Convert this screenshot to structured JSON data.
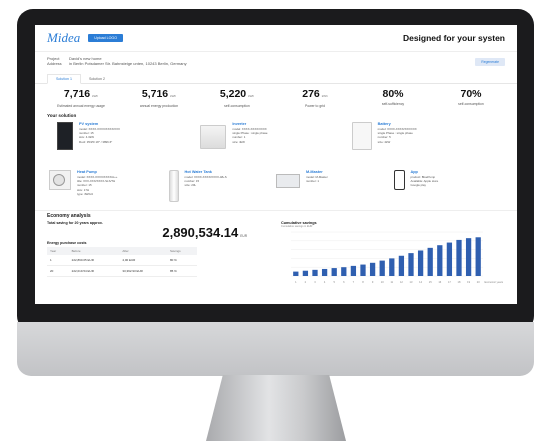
{
  "header": {
    "logo": "Midea",
    "upload_label": "Upload LOGO",
    "tagline": "Designed for your systen"
  },
  "project": {
    "project_key": "Project",
    "project_value": "David's new home",
    "address_key": "Address",
    "address_value": "in Berlin Potsdamer Str. Bahnsteige unten, 10243 Berlin, Germany",
    "regen_label": "Regenerate"
  },
  "tabs": [
    {
      "label": "Solution 1"
    },
    {
      "label": "Solution 2"
    }
  ],
  "kpis": [
    {
      "value": "7,716",
      "unit": "kWh",
      "label": "Estimated annual energy usage"
    },
    {
      "value": "5,716",
      "unit": "kWh",
      "label": "annual energy production"
    },
    {
      "value": "5,220",
      "unit": "kWh",
      "label": "self-consumption"
    },
    {
      "value": "276",
      "unit": "kWh",
      "label": "Power to grid"
    },
    {
      "value": "80%",
      "unit": "",
      "label": "self-sufficiency"
    },
    {
      "value": "70%",
      "unit": "",
      "label": "self-consumption"
    }
  ],
  "solution_title": "Your solution",
  "products": [
    {
      "title": "PV system",
      "lines": [
        "model: XXXX-XXXX/XXXX/XXX",
        "number: 15",
        "size: 4.3kW",
        "Roof: 35/25/ 18° / 3896.6°"
      ]
    },
    {
      "title": "Inverter",
      "lines": [
        "model: XXXX-XXXX/XXXX",
        "single Phase : single phase",
        "number: 1",
        "size: 4kW"
      ]
    },
    {
      "title": "Battery",
      "lines": [
        "model: XXXX-XXXX/XXXX/XX",
        "single Phase : single phase",
        "number: 5",
        "size: 4kW"
      ]
    },
    {
      "title": "Heat Pump",
      "lines": [
        "model: XXXX-XXXX/XXXX/A++",
        "title: XXX-XXX/XXXX-SLS/TH",
        "number: 15",
        "size: 17H",
        "type: 4W/H4"
      ]
    },
    {
      "title": "Hot Water Tank",
      "lines": [
        "model: XXXX-XXXX/XXXX-48+S",
        "number: 15",
        "size: 20L"
      ]
    },
    {
      "title": "M-Master",
      "lines": [
        "model: M-Master",
        "number: 1"
      ]
    },
    {
      "title": "App",
      "lines": [
        "product: BluePump",
        "Available: Apple store",
        "Google play"
      ]
    }
  ],
  "economy": {
    "title": "Economy analysis",
    "total_label": "Total saving for 20 years approx.",
    "total_value": "2,890,534.14",
    "total_unit": "EUR",
    "costs_title": "Energy purchase costs",
    "columns": [
      "Year",
      "Before",
      "After",
      "Savings"
    ],
    "rows": [
      [
        "1",
        "222,890.05 EUR",
        "4,00 EUR",
        "80 %"
      ],
      [
        "20",
        "222,019.54 EUR",
        "33,392.93 EUR",
        "85 %"
      ]
    ]
  },
  "chart_data": {
    "type": "bar",
    "title": "Cumulative savings",
    "subtitle": "Cumulative savings in EUR",
    "categories": [
      "1",
      "2",
      "3",
      "4",
      "5",
      "6",
      "7",
      "8",
      "9",
      "10",
      "11",
      "12",
      "13",
      "14",
      "15",
      "16",
      "17",
      "18",
      "19",
      "20"
    ],
    "values": [
      10,
      12,
      14,
      16,
      18,
      20,
      23,
      26,
      30,
      35,
      40,
      46,
      52,
      58,
      64,
      70,
      76,
      82,
      86,
      88
    ],
    "xlabel": "Economic years",
    "ylim": [
      0,
      100
    ],
    "bar_color": "#2f5fb0"
  }
}
